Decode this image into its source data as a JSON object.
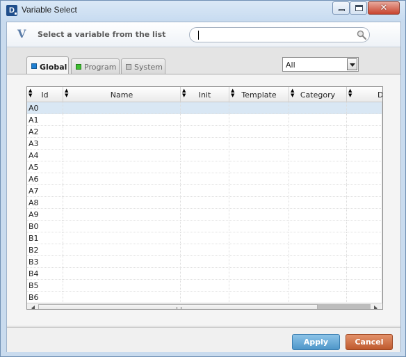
{
  "window": {
    "logo_letter": "D",
    "title": "Variable Select",
    "close_glyph": "✕"
  },
  "header": {
    "logo_letter": "V",
    "text": "Select a variable from the list",
    "search": {
      "value": "",
      "placeholder": ""
    }
  },
  "tabs": [
    {
      "label": "Global",
      "selected": true,
      "color": "#1e7fd2"
    },
    {
      "label": "Program",
      "selected": false,
      "color": "#3fbf32"
    },
    {
      "label": "System",
      "selected": false,
      "color": "#c8c8c8"
    }
  ],
  "filter": {
    "selected": "All"
  },
  "grid": {
    "columns": [
      "Id",
      "Name",
      "Init",
      "Template",
      "Category",
      "D"
    ],
    "rows": [
      {
        "id": "A0",
        "selected": true
      },
      {
        "id": "A1"
      },
      {
        "id": "A2"
      },
      {
        "id": "A3"
      },
      {
        "id": "A4"
      },
      {
        "id": "A5"
      },
      {
        "id": "A6"
      },
      {
        "id": "A7"
      },
      {
        "id": "A8"
      },
      {
        "id": "A9"
      },
      {
        "id": "B0"
      },
      {
        "id": "B1"
      },
      {
        "id": "B2"
      },
      {
        "id": "B3"
      },
      {
        "id": "B4"
      },
      {
        "id": "B5"
      },
      {
        "id": "B6"
      }
    ]
  },
  "footer": {
    "apply_label": "Apply",
    "cancel_label": "Cancel"
  }
}
